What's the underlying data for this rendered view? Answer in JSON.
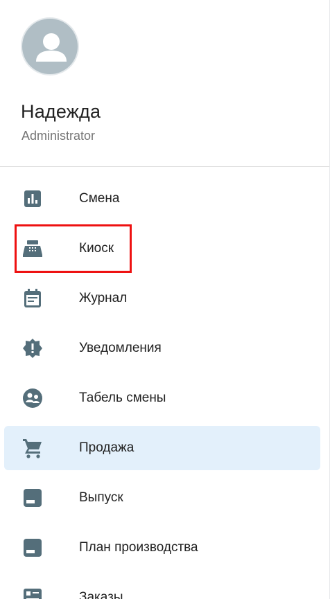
{
  "user": {
    "name": "Надежда",
    "role": "Administrator"
  },
  "menu": {
    "items": [
      {
        "label": "Смена",
        "icon": "bar-chart-icon"
      },
      {
        "label": "Киоск",
        "icon": "cash-register-icon"
      },
      {
        "label": "Журнал",
        "icon": "calendar-list-icon"
      },
      {
        "label": "Уведомления",
        "icon": "alert-badge-icon"
      },
      {
        "label": "Табель смены",
        "icon": "staff-schedule-icon"
      },
      {
        "label": "Продажа",
        "icon": "cart-icon",
        "active": true
      },
      {
        "label": "Выпуск",
        "icon": "box-icon"
      },
      {
        "label": "План производства",
        "icon": "box-icon"
      },
      {
        "label": "Заказы",
        "icon": "orders-icon"
      }
    ]
  },
  "colors": {
    "icon": "#546e7a",
    "active_bg": "#e3f0fb",
    "highlight": "#ee1111"
  }
}
